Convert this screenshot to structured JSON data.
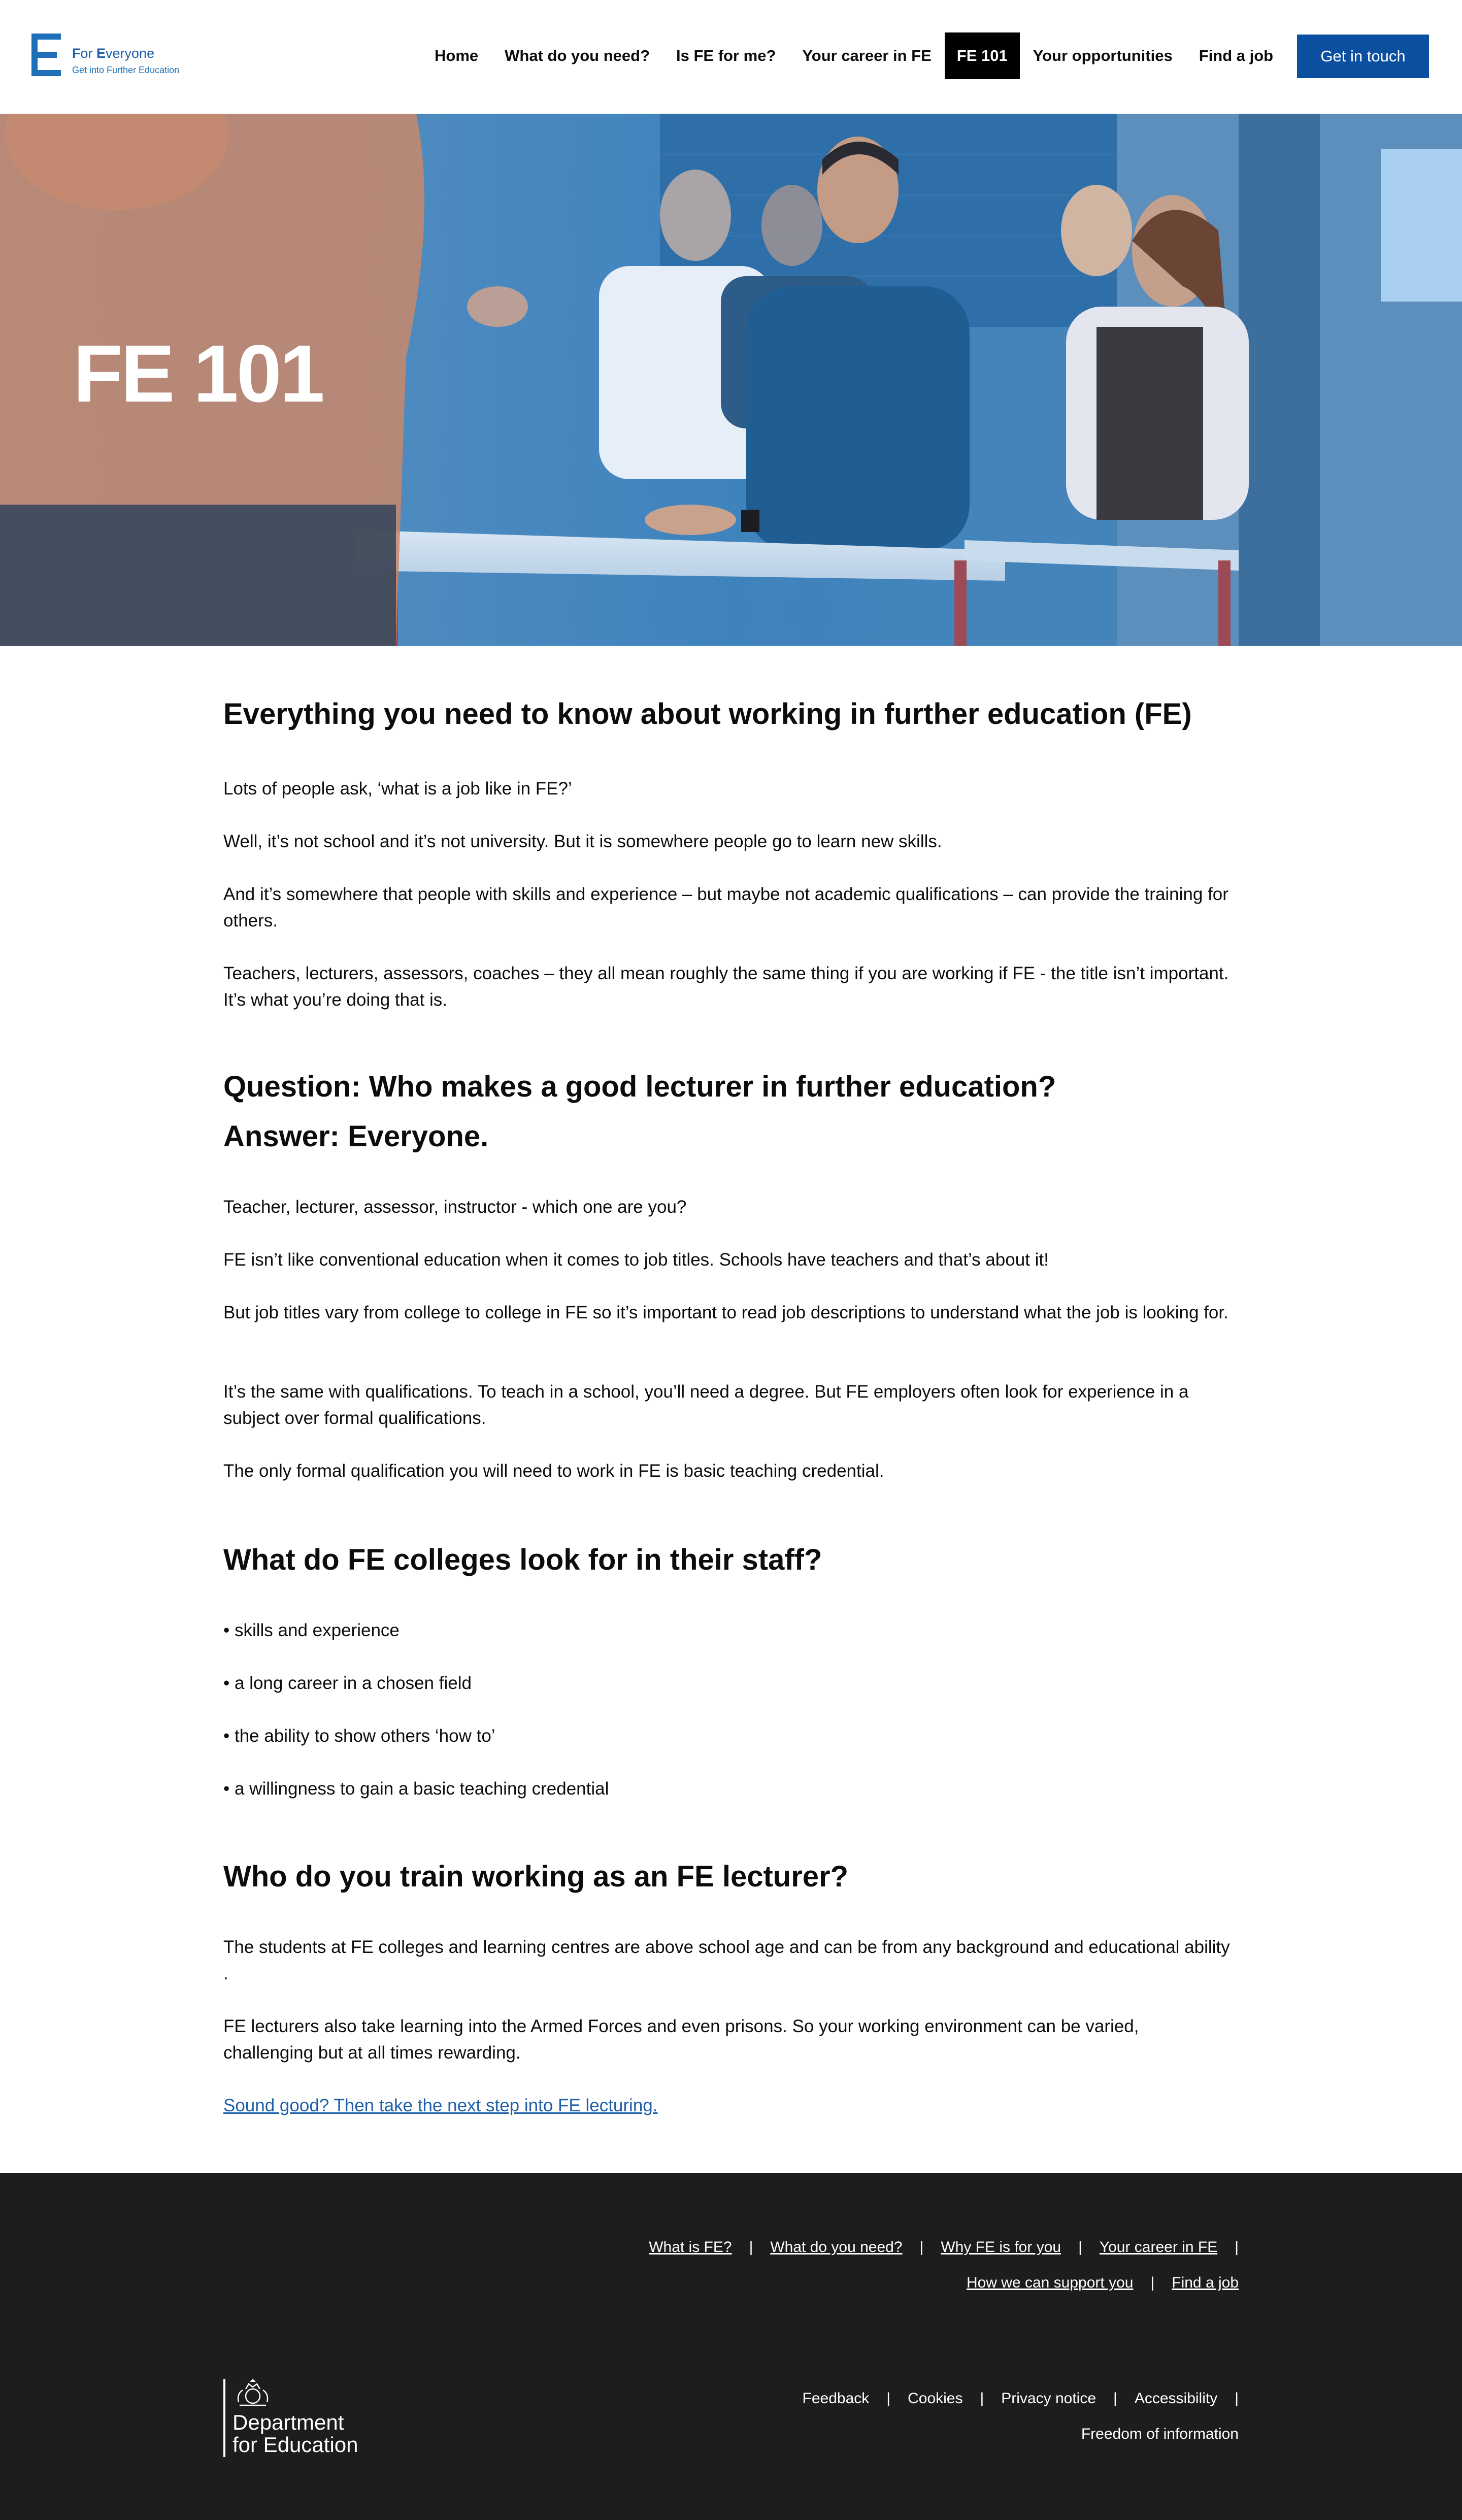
{
  "header": {
    "logo_title_prefix": "F",
    "logo_title_rest": "or ",
    "logo_title_e": "E",
    "logo_title_end": "veryone",
    "logo_sub": "Get into Further Education",
    "nav": [
      {
        "label": "Home"
      },
      {
        "label": "What do you need?"
      },
      {
        "label": "Is FE for me?"
      },
      {
        "label": "Your career in FE"
      },
      {
        "label": "FE 101",
        "active": true
      },
      {
        "label": "Your opportunities"
      },
      {
        "label": "Find a job"
      }
    ],
    "cta_label": "Get in touch"
  },
  "hero": {
    "title": "FE 101"
  },
  "content": {
    "heading_1": "Everything you need to know about working in further education (FE)",
    "intro": [
      "Lots of people ask, ‘what is a job like in FE?’",
      "Well, it’s not school and it’s not university. But it is somewhere people go to learn new skills.",
      "And it’s somewhere that people with skills and experience – but maybe not academic qualifications – can provide the training for others.",
      "Teachers, lecturers, assessors, coaches – they all mean roughly the same thing if you are working if FE  - the title isn’t important. It’s what you’re doing that is."
    ],
    "heading_2a": "Question: Who makes a good lecturer in further education?",
    "heading_2b": "Answer: Everyone.",
    "answer": [
      "Teacher, lecturer, assessor, instructor - which one are you?",
      "FE isn’t like conventional education when it comes to job titles. Schools have teachers and that’s about it!",
      "But job titles vary from college to college in FE so it’s important to read job descriptions to understand what the job is looking for.",
      "It’s the same with qualifications. To teach in a school, you’ll need a degree. But FE employers often look for experience in a subject over formal qualifications.",
      "The only formal qualification you will need to work in FE is basic teaching credential."
    ],
    "heading_3": "What do FE colleges look for in their staff?",
    "bullets": [
      "• skills and experience",
      "• a long career in a chosen field",
      "• the ability to show others ‘how to’",
      "• a willingness to gain a basic teaching credential"
    ],
    "heading_4": "Who do you train working as an FE lecturer?",
    "train": [
      "The students at FE colleges and learning centres are above school age and can be from any background and educational ability .",
      "FE lecturers also take learning into the Armed Forces and even prisons. So your working environment can be varied, challenging but at all times rewarding."
    ],
    "next_link": "Sound good? Then take the next step into FE lecturing."
  },
  "footer": {
    "nav_row1": [
      "What is FE?",
      "What do you need?",
      "Why FE is for you",
      "Your career in FE"
    ],
    "nav_row2": [
      "How we can support you",
      "Find a job"
    ],
    "dfe_line1": "Department",
    "dfe_line2": "for Education",
    "legal_row1": [
      "Feedback",
      "Cookies",
      "Privacy notice",
      "Accessibility"
    ],
    "legal_row2": [
      "Freedom of information"
    ]
  },
  "colors": {
    "brand_blue": "#0b4fa0",
    "link_blue": "#1d5fa8",
    "footer_bg": "#1d1d1b"
  }
}
